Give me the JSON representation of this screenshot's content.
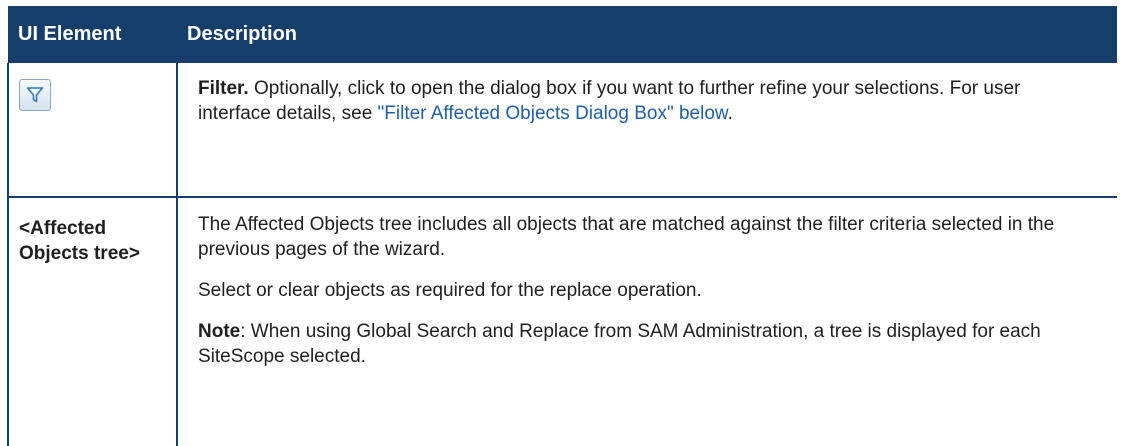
{
  "table": {
    "headers": {
      "element": "UI Element",
      "description": "Description"
    },
    "filter_row": {
      "icon": "filter-icon",
      "title": "Filter.",
      "text_before_link": " Optionally, click to open the dialog box if you want to further refine your selections. For user interface details, see ",
      "link": "\"Filter Affected Objects Dialog Box\" below",
      "text_after_link": "."
    },
    "tree_row": {
      "element": "<Affected Objects tree>",
      "paragraph1": "The Affected Objects tree includes all objects that are matched against the filter criteria selected in the previous pages of the wizard.",
      "paragraph2": "Select or clear objects as required for the replace operation.",
      "note_label": "Note",
      "note_text": ": When using Global Search and Replace from SAM Administration, a tree is displayed for each SiteScope selected."
    }
  },
  "colors": {
    "header_bg": "#163e6b",
    "header_text": "#ffffff",
    "link": "#1f5fa8"
  }
}
